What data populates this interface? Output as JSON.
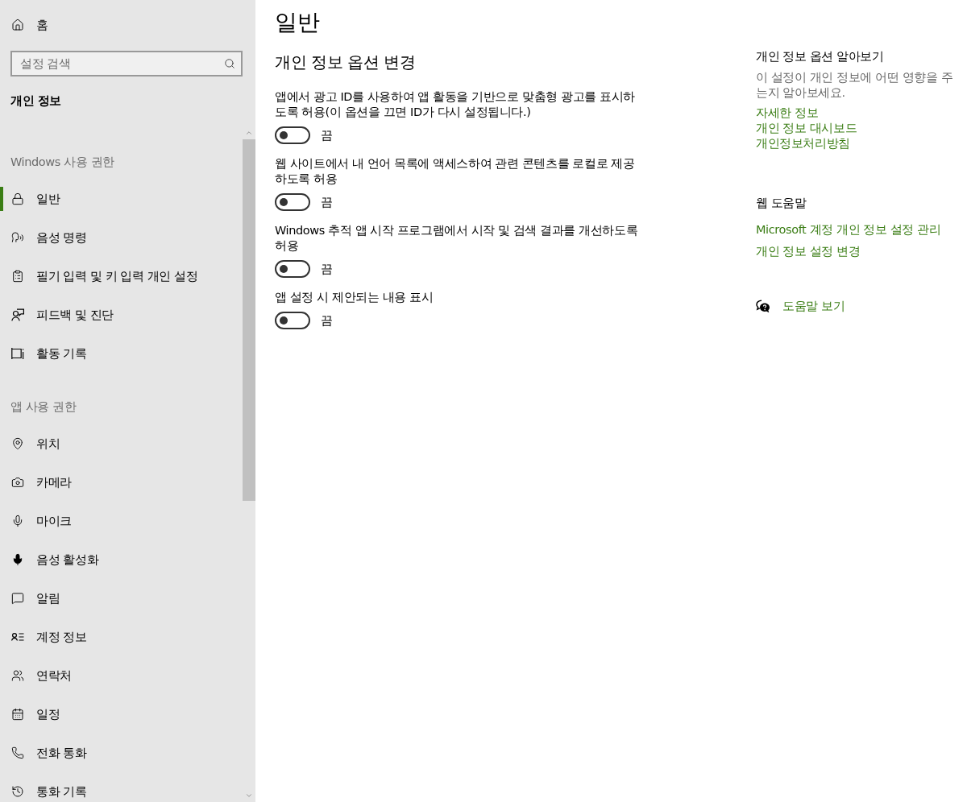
{
  "sidebar": {
    "home": {
      "label": "홈"
    },
    "search": {
      "placeholder": "설정 검색"
    },
    "section_title": "개인 정보",
    "groups": [
      {
        "heading": "Windows 사용 권한",
        "items": [
          {
            "label": "일반",
            "selected": true
          },
          {
            "label": "음성 명령",
            "selected": false
          },
          {
            "label": "필기 입력 및 키 입력 개인 설정",
            "selected": false
          },
          {
            "label": "피드백 및 진단",
            "selected": false
          },
          {
            "label": "활동 기록",
            "selected": false
          }
        ]
      },
      {
        "heading": "앱 사용 권한",
        "items": [
          {
            "label": "위치",
            "selected": false
          },
          {
            "label": "카메라",
            "selected": false
          },
          {
            "label": "마이크",
            "selected": false
          },
          {
            "label": "음성 활성화",
            "selected": false
          },
          {
            "label": "알림",
            "selected": false
          },
          {
            "label": "계정 정보",
            "selected": false
          },
          {
            "label": "연락처",
            "selected": false
          },
          {
            "label": "일정",
            "selected": false
          },
          {
            "label": "전화 통화",
            "selected": false
          },
          {
            "label": "통화 기록",
            "selected": false
          }
        ]
      }
    ]
  },
  "page": {
    "title": "일반",
    "subtitle": "개인 정보 옵션 변경",
    "options": [
      {
        "label": "앱에서 광고 ID를 사용하여 앱 활동을 기반으로 맞춤형 광고를 표시하도록 허용(이 옵션을 끄면 ID가 다시 설정됩니다.)",
        "on": false,
        "state_text": "끔"
      },
      {
        "label": "웹 사이트에서 내 언어 목록에 액세스하여 관련 콘텐츠를 로컬로 제공하도록 허용",
        "on": false,
        "state_text": "끔"
      },
      {
        "label": "Windows 추적 앱 시작 프로그램에서 시작 및 검색 결과를 개선하도록 허용",
        "on": false,
        "state_text": "끔"
      },
      {
        "label": "앱 설정 시 제안되는 내용 표시",
        "on": false,
        "state_text": "끔"
      }
    ]
  },
  "aside": {
    "sections": [
      {
        "heading": "개인 정보 옵션 알아보기",
        "description": "이 설정이 개인 정보에 어떤 영향을 주는지 알아보세요.",
        "links": [
          "자세한 정보",
          "개인 정보 대시보드",
          "개인정보처리방침"
        ]
      },
      {
        "heading": "웹 도움말",
        "links": [
          "Microsoft 계정 개인 정보 설정 관리",
          "개인 정보 설정 변경"
        ]
      }
    ],
    "help_link": "도움말 보기"
  }
}
